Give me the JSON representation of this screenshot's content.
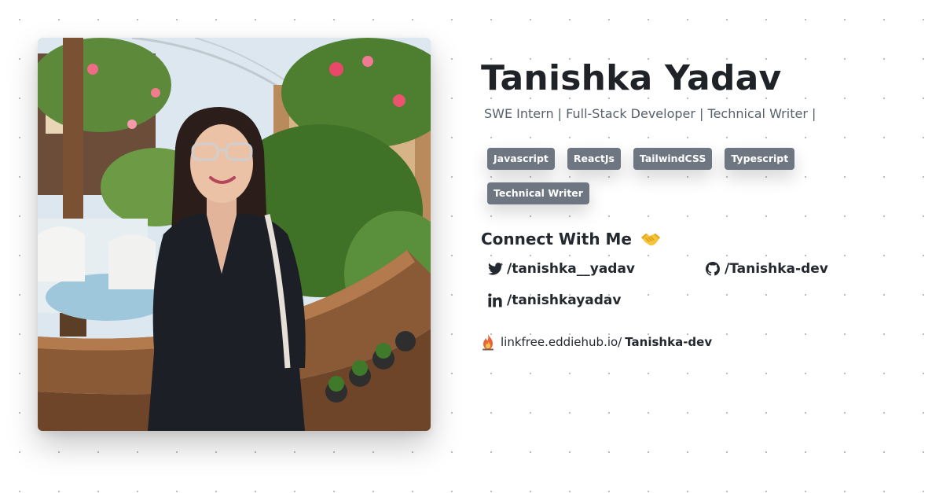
{
  "profile": {
    "name": "Tanishka Yadav",
    "tagline": "SWE Intern | Full-Stack Developer | Technical Writer |"
  },
  "skills": [
    "Javascript",
    "ReactJs",
    "TailwindCSS",
    "Typescript",
    "Technical Writer"
  ],
  "connect": {
    "title": "Connect With Me",
    "emoji": "handshake-emoji",
    "links": {
      "twitter": {
        "icon": "twitter-icon",
        "label": "/tanishka__yadav"
      },
      "github": {
        "icon": "github-icon",
        "label": "/Tanishka-dev"
      },
      "linkedin": {
        "icon": "linkedin-icon",
        "label": "/tanishkayadav"
      }
    }
  },
  "linkfree": {
    "icon": "linkfree-flame-icon",
    "prefix": "linkfree.eddiehub.io/",
    "handle": "Tanishka-dev"
  },
  "colors": {
    "badge_bg": "#6e7681",
    "text": "#1f2328",
    "muted": "#57606a"
  }
}
